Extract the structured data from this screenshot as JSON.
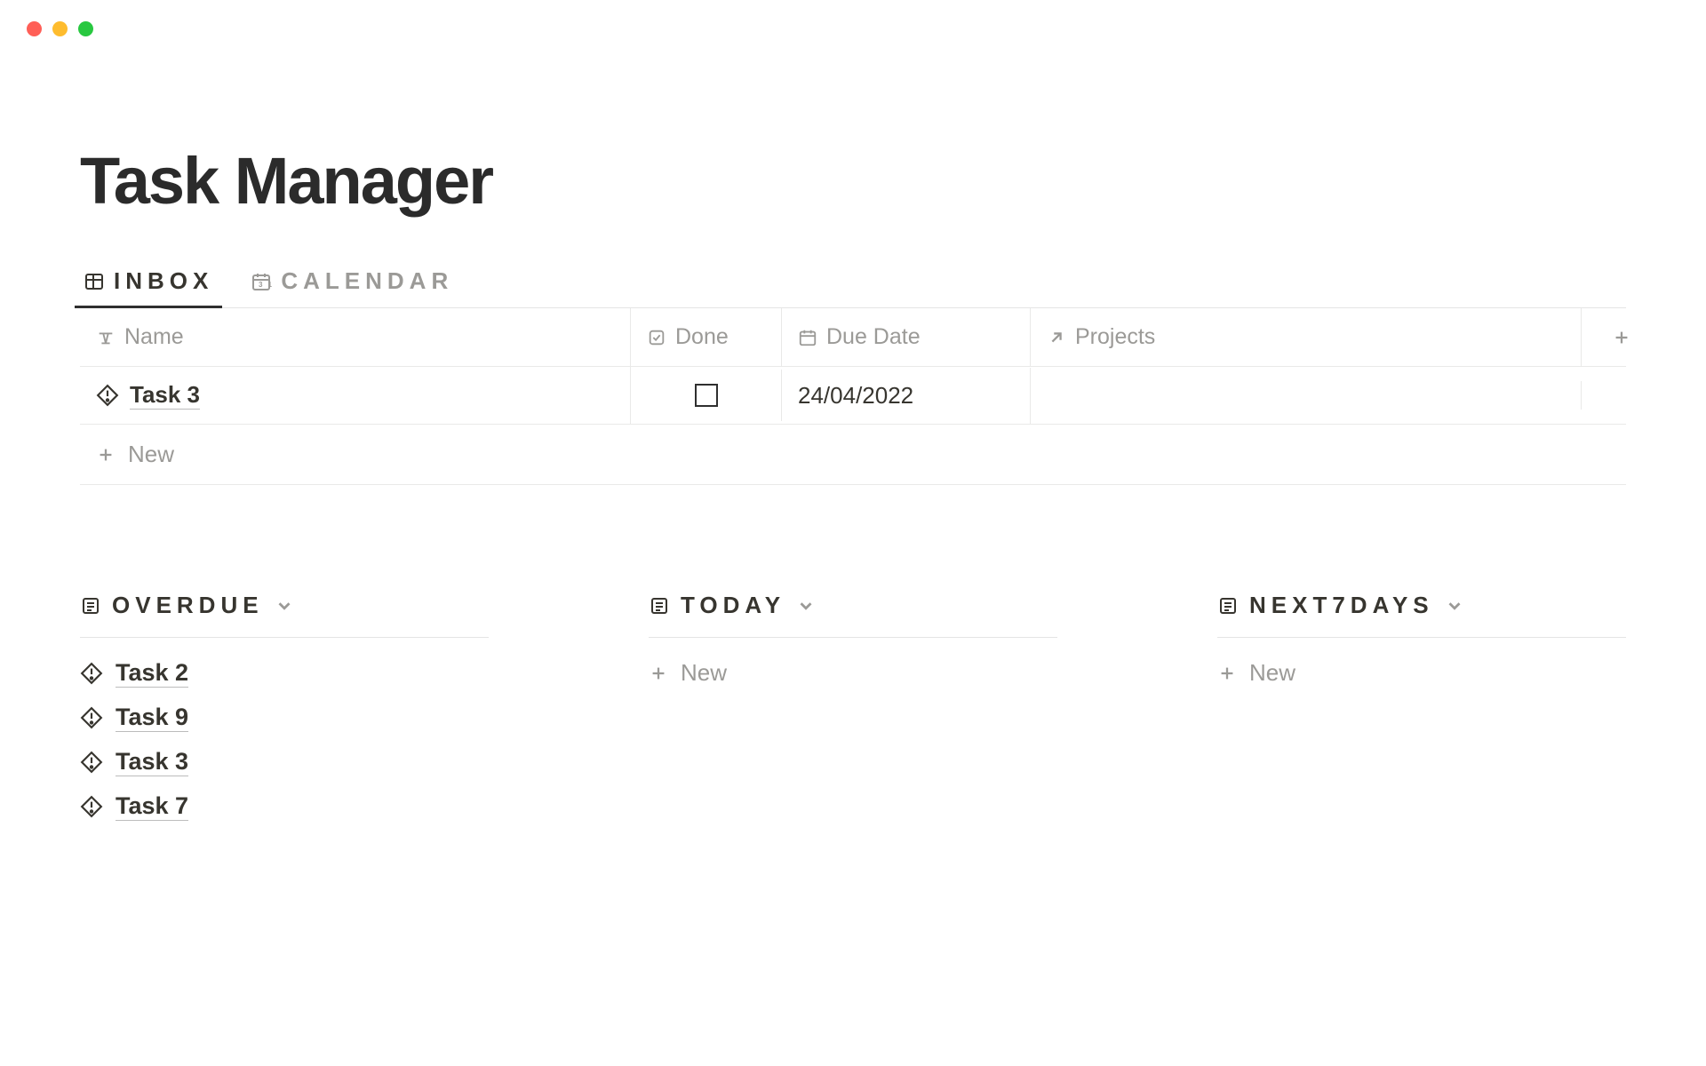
{
  "page_title": "Task Manager",
  "view_tabs": {
    "inbox": "INBOX",
    "calendar": "CALENDAR"
  },
  "columns": {
    "name": "Name",
    "done": "Done",
    "due": "Due Date",
    "projects": "Projects"
  },
  "inbox_rows": [
    {
      "name": "Task 3",
      "done": false,
      "due": "24/04/2022",
      "projects": ""
    }
  ],
  "new_label": "New",
  "sections": {
    "overdue": {
      "title": "OVERDUE",
      "items": [
        "Task 2",
        "Task 9",
        "Task 3",
        "Task 7"
      ]
    },
    "today": {
      "title": "TODAY",
      "items": []
    },
    "next7": {
      "title": "NEXT7DAYS",
      "items": []
    }
  }
}
